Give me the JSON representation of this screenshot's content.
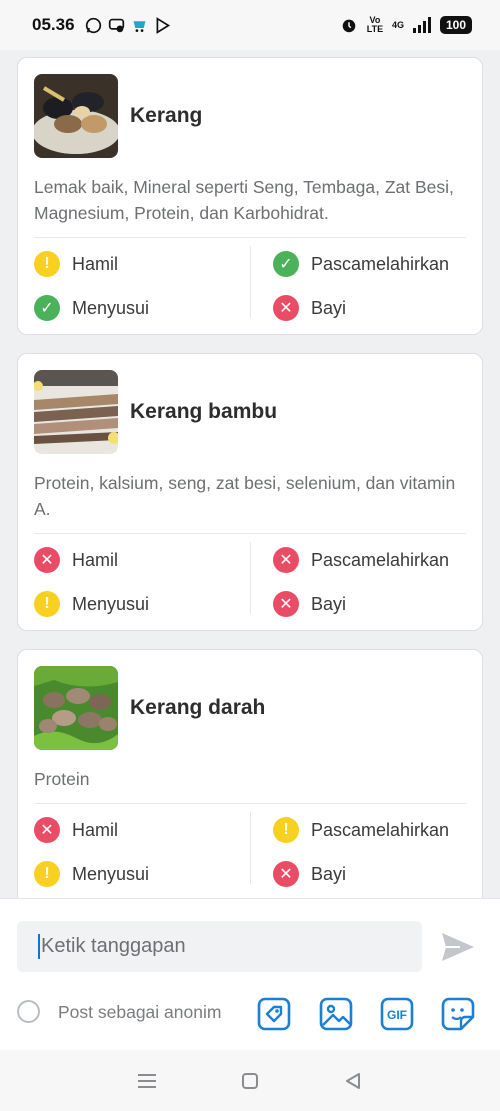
{
  "status_bar": {
    "time": "05.36",
    "network": "4G",
    "volte": "Vo LTE",
    "battery": "100"
  },
  "cards": [
    {
      "title": "Kerang",
      "description": "Lemak baik, Mineral seperti Seng, Tembaga, Zat Besi, Magnesium, Protein, dan Karbohidrat.",
      "statuses": [
        {
          "label": "Hamil",
          "state": "warn"
        },
        {
          "label": "Pascamelahirkan",
          "state": "ok"
        },
        {
          "label": "Menyusui",
          "state": "ok"
        },
        {
          "label": "Bayi",
          "state": "no"
        }
      ]
    },
    {
      "title": "Kerang bambu",
      "description": "Protein, kalsium, seng, zat besi, selenium, dan vitamin A.",
      "statuses": [
        {
          "label": "Hamil",
          "state": "no"
        },
        {
          "label": "Pascamelahirkan",
          "state": "no"
        },
        {
          "label": "Menyusui",
          "state": "warn"
        },
        {
          "label": "Bayi",
          "state": "no"
        }
      ]
    },
    {
      "title": "Kerang darah",
      "description": "Protein",
      "statuses": [
        {
          "label": "Hamil",
          "state": "no"
        },
        {
          "label": "Pascamelahirkan",
          "state": "warn"
        },
        {
          "label": "Menyusui",
          "state": "warn"
        },
        {
          "label": "Bayi",
          "state": "no"
        }
      ]
    }
  ],
  "composer": {
    "placeholder": "Ketik tanggapan",
    "anon_label": "Post sebagai anonim",
    "tools": [
      "tag-icon",
      "image-icon",
      "gif-icon",
      "sticker-icon"
    ],
    "gif_label": "GIF"
  },
  "colors": {
    "warn": "#f8d020",
    "ok": "#4cb25a",
    "no": "#ea4c66",
    "accent": "#1b7fd6"
  }
}
